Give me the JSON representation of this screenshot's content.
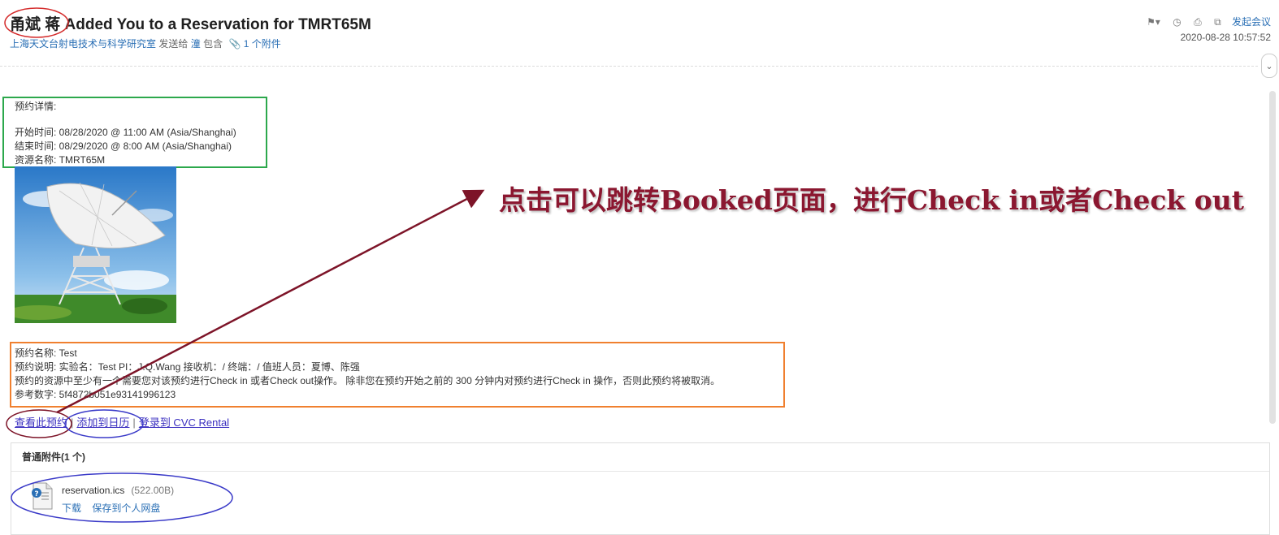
{
  "header": {
    "subject": "甬斌 蒋 Added You to a Reservation for TMRT65M",
    "sender": "上海天文台射电技术与科学研究室",
    "sent_to": "发送给",
    "recipient": "潼",
    "contains": "包含",
    "attachment_count": "1 个附件",
    "start_meeting": "发起会议",
    "datetime": "2020-08-28 10:57:52"
  },
  "details": {
    "heading": "预约详情:",
    "start": "开始时间: 08/28/2020 @ 11:00 AM (Asia/Shanghai)",
    "end": "结束时间: 08/29/2020 @ 8:00 AM (Asia/Shanghai)",
    "resource": "资源名称: TMRT65M"
  },
  "reservation": {
    "name": "预约名称: Test",
    "description": "预约说明: 实验名：Test PI：J.Q.Wang 接收机：/ 终端：/ 值班人员：夏博、陈强",
    "notice": "预约的资源中至少有一个需要您对该预约进行Check in 或者Check out操作。 除非您在预约开始之前的 300 分钟内对预约进行Check in 操作，否则此预约将被取消。",
    "reference": "参考数字: 5f4872b051e93141996123"
  },
  "links": {
    "view": "查看此预约",
    "add_calendar": "添加到日历",
    "login": "登录到 CVC Rental",
    "separator": "|"
  },
  "attachments": {
    "heading": "普通附件(1 个)",
    "file_name": "reservation.ics",
    "file_size": "(522.00B)",
    "download": "下载",
    "save": "保存到个人网盘"
  },
  "annotation": {
    "text": "点击可以跳转Booked页面，进行Check in或者Check out"
  },
  "icons": {
    "flag": "flag-icon",
    "clock": "clock-icon",
    "print": "print-icon",
    "popout": "popout-icon",
    "collapse": "chevron-down-icon",
    "attachment": "paperclip-icon",
    "file": "calendar-file-icon"
  },
  "colors": {
    "link_blue": "#2a6fb5",
    "annotation_red": "#8b1730",
    "green_box": "#2ca84c",
    "orange_box": "#f0802f",
    "blue_ellipse": "#3a3ac8",
    "red_ellipse": "#d42a2a"
  }
}
